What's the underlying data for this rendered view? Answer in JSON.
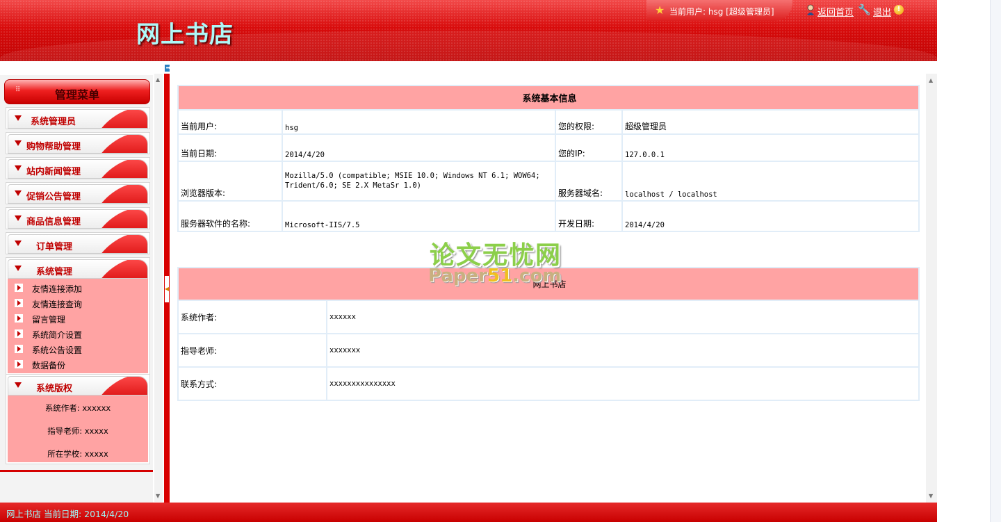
{
  "header": {
    "site_title": "网上书店",
    "current_user": "当前用户: hsg [超级管理员]",
    "home_link": "返回首页",
    "logout_link": "退出"
  },
  "sidebar": {
    "menu_title": "管理菜单",
    "sections": [
      {
        "label": "系统管理员"
      },
      {
        "label": "购物帮助管理"
      },
      {
        "label": "站内新闻管理"
      },
      {
        "label": "促销公告管理"
      },
      {
        "label": "商品信息管理"
      },
      {
        "label": "订单管理"
      },
      {
        "label": "系统管理",
        "expanded": true,
        "items": [
          "友情连接添加",
          "友情连接查询",
          "留言管理",
          "系统简介设置",
          "系统公告设置",
          "数据备份"
        ]
      },
      {
        "label": "系统版权",
        "expanded": true
      }
    ],
    "copyright": {
      "author": "系统作者: xxxxxx",
      "teacher": "指导老师: xxxxx",
      "school": "所在学校: xxxxx"
    }
  },
  "system_info": {
    "heading": "系统基本信息",
    "rows": [
      {
        "l1": "当前用户:",
        "v1": "hsg",
        "l2": "您的权限:",
        "v2": "超级管理员"
      },
      {
        "l1": "当前日期:",
        "v1": "2014/4/20",
        "l2": "您的IP:",
        "v2": "127.0.0.1"
      },
      {
        "l1": "浏览器版本:",
        "v1": "Mozilla/5.0 (compatible; MSIE 10.0; Windows NT 6.1; WOW64; Trident/6.0; SE 2.X MetaSr 1.0)",
        "l2": "服务器域名:",
        "v2": "localhost / localhost"
      },
      {
        "l1": "服务器软件的名称:",
        "v1": "Microsoft-IIS/7.5",
        "l2": "开发日期:",
        "v2": "2014/4/20"
      }
    ]
  },
  "author_info": {
    "heading": "网上书店",
    "rows": [
      {
        "label": "系统作者:",
        "value": "xxxxxx"
      },
      {
        "label": "指导老师:",
        "value": "xxxxxxx"
      },
      {
        "label": "联系方式:",
        "value": "xxxxxxxxxxxxxxx"
      }
    ]
  },
  "watermark": {
    "cn": "论文无忧网",
    "en_part1": "Paper",
    "en_part2": "51",
    "en_part3": ".com"
  },
  "footer": {
    "text": "网上书店 当前日期: 2014/4/20"
  },
  "colors": {
    "brand_red": "#d80c0c",
    "table_header": "#ffa3a3",
    "title_cyan": "#aef8f8"
  }
}
